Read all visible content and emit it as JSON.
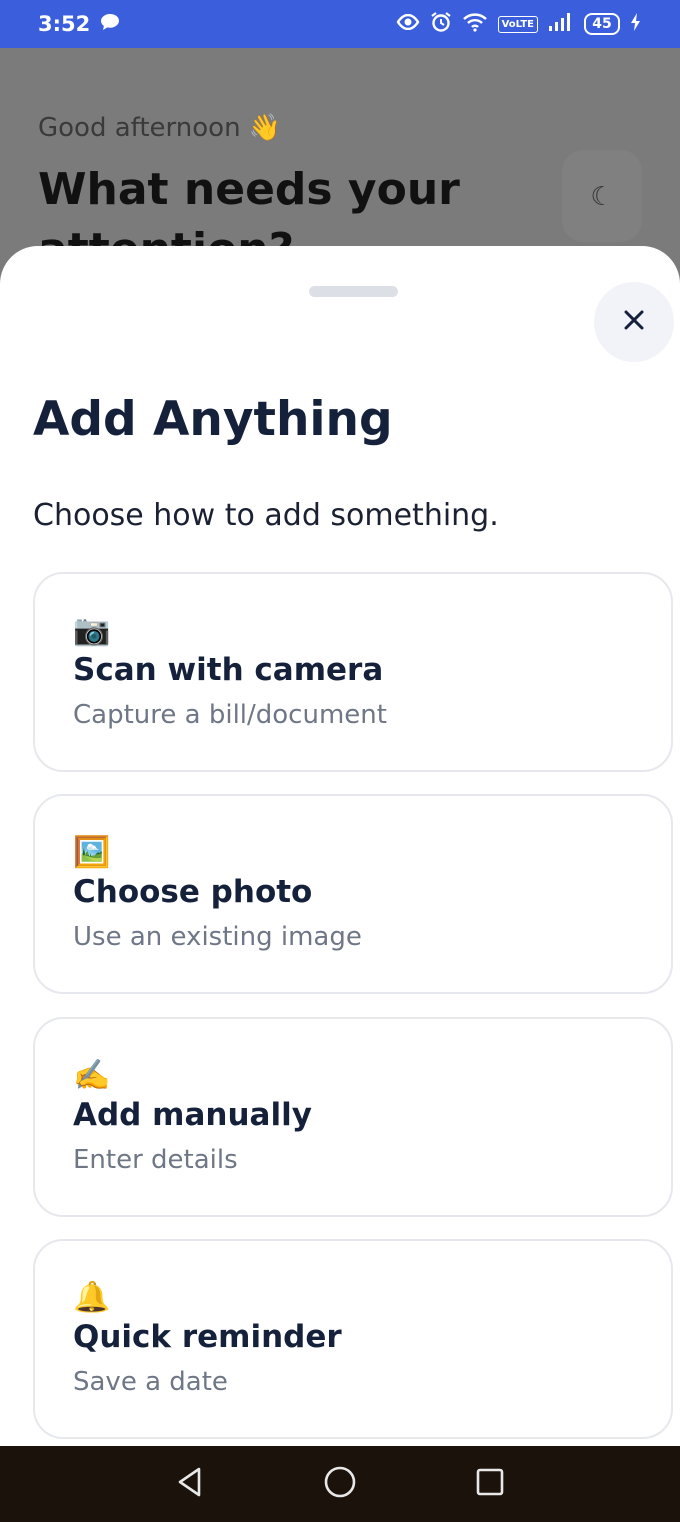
{
  "status_bar": {
    "time": "3:52",
    "volte": "VoLTE",
    "battery": "45",
    "icons": [
      "chat-bubble-icon",
      "eye-icon",
      "alarm-icon",
      "wifi-icon",
      "signal-icon",
      "charging-icon"
    ]
  },
  "background": {
    "greeting": "Good afternoon 👋",
    "headline": "What needs your attention?",
    "theme_icon": "☾"
  },
  "sheet": {
    "title": "Add Anything",
    "subtitle": "Choose how to add something.",
    "options": [
      {
        "icon": "📷",
        "title": "Scan with camera",
        "description": "Capture a bill/document"
      },
      {
        "icon": "🖼️",
        "title": "Choose photo",
        "description": "Use an existing image"
      },
      {
        "icon": "✍️",
        "title": "Add manually",
        "description": "Enter details"
      },
      {
        "icon": "🔔",
        "title": "Quick reminder",
        "description": "Save a date"
      }
    ]
  },
  "colors": {
    "status_bar": "#3b5fdc",
    "title_text": "#15213a",
    "muted_text": "#6f7787",
    "nav_bar": "#1c120c"
  }
}
